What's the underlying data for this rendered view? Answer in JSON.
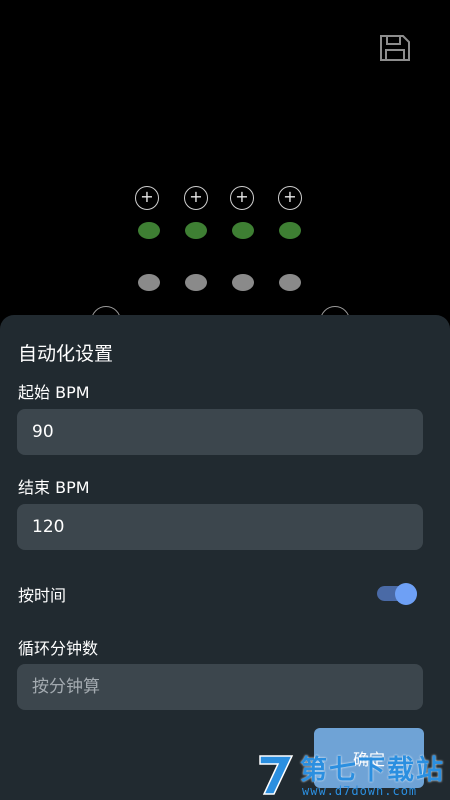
{
  "toolbar": {
    "save_icon": "save-icon"
  },
  "beat_grid": {
    "columns": 4,
    "plus_symbol": "+",
    "active_color": "#3e7f33",
    "inactive_color": "#8a8a8a"
  },
  "sheet": {
    "title": "自动化设置",
    "start_bpm": {
      "label": "起始 BPM",
      "value": "90"
    },
    "end_bpm": {
      "label": "结束 BPM",
      "value": "120"
    },
    "by_time": {
      "label": "按时间",
      "enabled": true,
      "accent": "#6ea0f5"
    },
    "loop_minutes": {
      "label": "循环分钟数",
      "placeholder": "按分钟算",
      "value": ""
    },
    "confirm_label": "确定"
  },
  "watermark": {
    "title": "第七下载站",
    "url": "www.d7down.com",
    "logo_letter": "7"
  }
}
